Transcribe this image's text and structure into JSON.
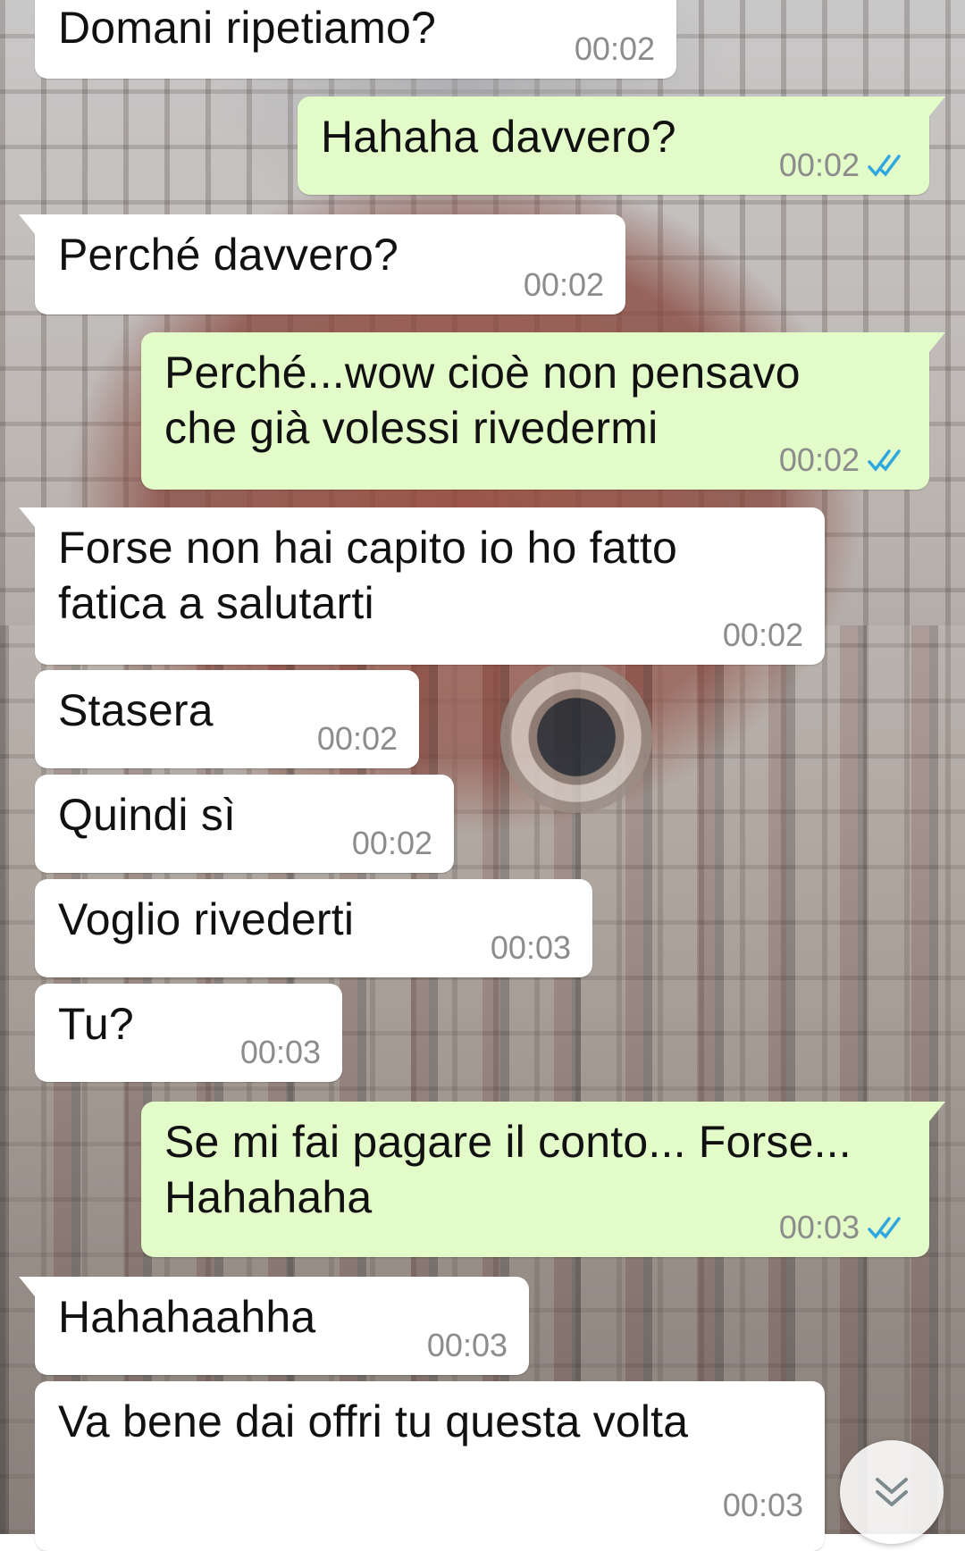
{
  "colors": {
    "incoming_bubble": "#ffffff",
    "outgoing_bubble": "#e2fbc9",
    "timestamp": "#8c8c8c",
    "read_ticks": "#2ea7e0"
  },
  "messages": [
    {
      "direction": "in",
      "text": "Domani ripetiamo?",
      "time": "00:02"
    },
    {
      "direction": "out",
      "text": "Hahaha davvero?",
      "time": "00:02",
      "status": "read"
    },
    {
      "direction": "in",
      "text": "Perché davvero?",
      "time": "00:02"
    },
    {
      "direction": "out",
      "text": "Perché...wow cioè non pensavo\nche già volessi rivedermi",
      "time": "00:02",
      "status": "read"
    },
    {
      "direction": "in",
      "text": "Forse non hai capito io ho fatto\nfatica a salutarti",
      "time": "00:02"
    },
    {
      "direction": "in",
      "text": "Stasera",
      "time": "00:02"
    },
    {
      "direction": "in",
      "text": "Quindi sì",
      "time": "00:02"
    },
    {
      "direction": "in",
      "text": "Voglio rivederti",
      "time": "00:03"
    },
    {
      "direction": "in",
      "text": "Tu?",
      "time": "00:03"
    },
    {
      "direction": "out",
      "text": "Se mi fai pagare il conto... Forse...\nHahahaha",
      "time": "00:03",
      "status": "read"
    },
    {
      "direction": "in",
      "text": "Hahahaahha",
      "time": "00:03"
    },
    {
      "direction": "in",
      "text": "Va bene dai offri tu questa volta",
      "time": "00:03"
    }
  ],
  "scroll_button": {
    "icon": "double-chevron-down-icon"
  }
}
